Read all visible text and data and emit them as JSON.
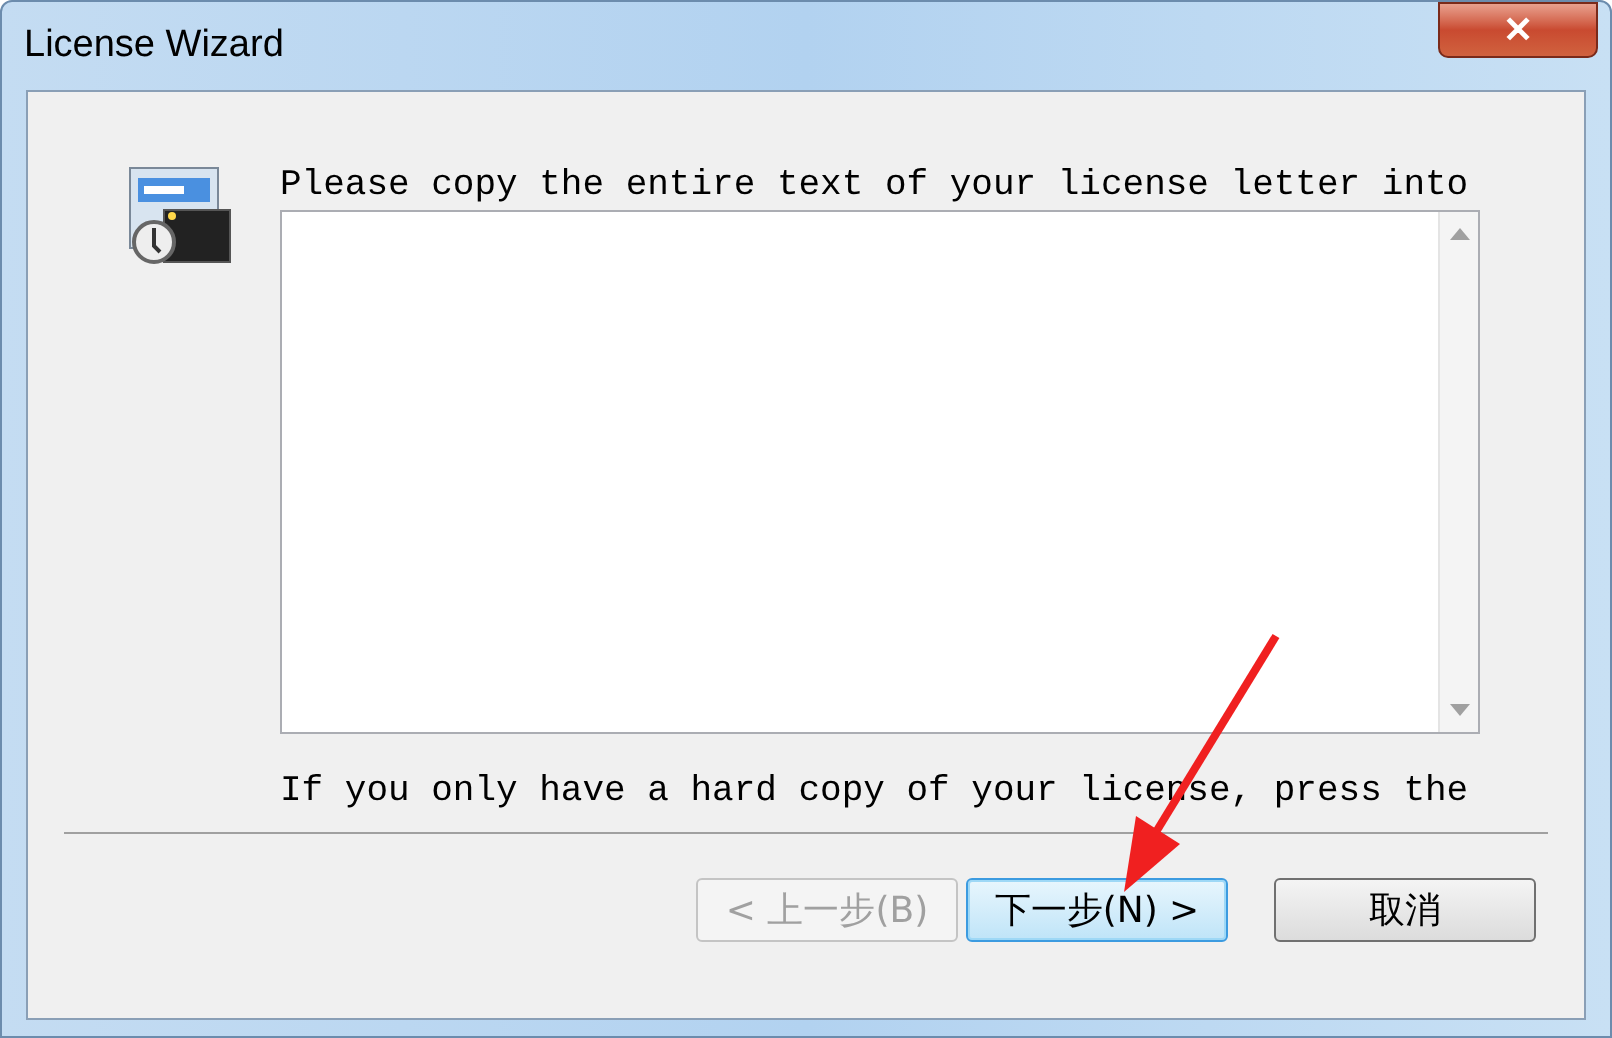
{
  "window": {
    "title": "License Wizard",
    "close_label": "✕"
  },
  "instruction": "Please copy the entire text of your license letter into",
  "hint": "If you only have a hard copy of your license, press the",
  "buttons": [
    {
      "label": "< 上一步(B)",
      "disabled": true,
      "default": false
    },
    {
      "label": "下一步(N) >",
      "disabled": false,
      "default": true
    },
    {
      "label": "取消",
      "disabled": false,
      "default": false
    }
  ]
}
